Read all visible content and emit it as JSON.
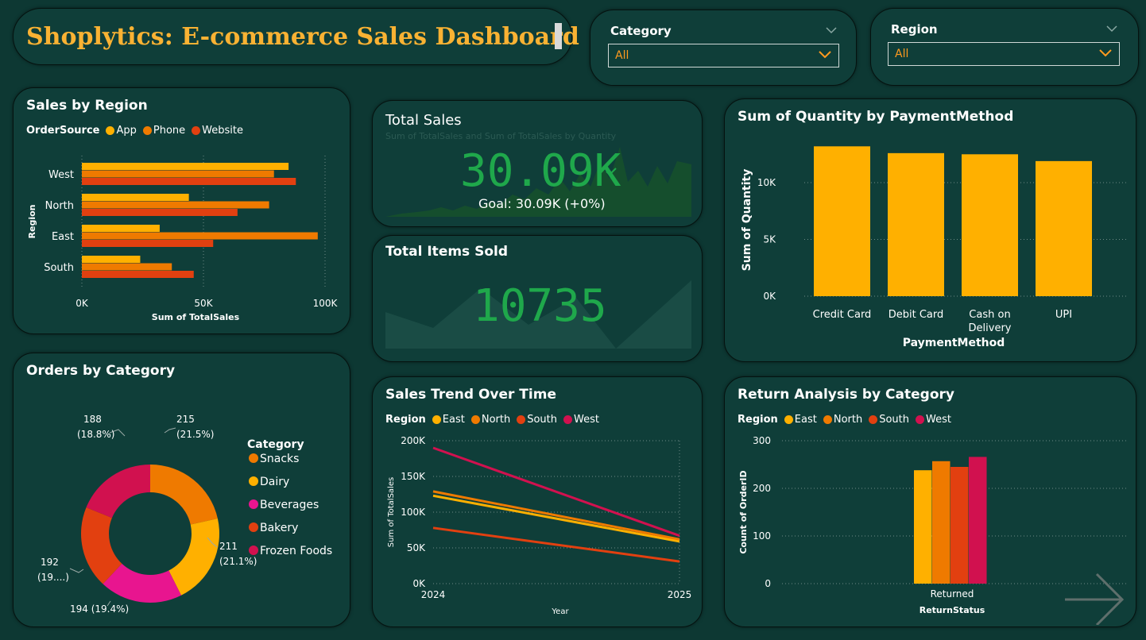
{
  "header": {
    "title": "Shoplytics: E-commerce Sales Dashboard"
  },
  "slicers": [
    {
      "label": "Category",
      "value": "All"
    },
    {
      "label": "Region",
      "value": "All"
    }
  ],
  "colors": {
    "background": "#0d3833",
    "yellow": "#ffb000",
    "orange": "#ef7a00",
    "red": "#e24010",
    "magenta": "#e01a7a",
    "crimson": "#d1114f",
    "green": "#1fa84b"
  },
  "kpis": {
    "total_sales": {
      "title": "Total Sales",
      "value": "30.09K",
      "goal": "Goal: 30.09K (+0%)",
      "faded_caption": "Sum of TotalSales and Sum of TotalSales by Quantity"
    },
    "total_items": {
      "title": "Total Items Sold",
      "value": "10735"
    }
  },
  "icons": {
    "kpi_check": "check-icon",
    "nav": "arrow-right-icon",
    "dropdown": "chevron-down-icon"
  },
  "chart_data": [
    {
      "id": "sales_by_region",
      "type": "bar",
      "orientation": "horizontal",
      "title": "Sales by Region",
      "legend_title": "OrderSource",
      "categories": [
        "West",
        "North",
        "East",
        "South"
      ],
      "series": [
        {
          "name": "App",
          "color": "#ffb000",
          "values": [
            85000,
            44000,
            32000,
            24000
          ]
        },
        {
          "name": "Phone",
          "color": "#ef7a00",
          "values": [
            79000,
            77000,
            97000,
            37000
          ]
        },
        {
          "name": "Website",
          "color": "#e24010",
          "values": [
            88000,
            64000,
            54000,
            46000
          ]
        }
      ],
      "xlabel": "Sum of TotalSales",
      "ylabel": "Region",
      "xlim": [
        0,
        100000
      ],
      "ticks": [
        "0K",
        "50K",
        "100K"
      ],
      "tick_values": [
        0,
        50000,
        100000
      ],
      "grid": true,
      "legend_position": "top"
    },
    {
      "id": "orders_by_category",
      "type": "pie",
      "donut": true,
      "title": "Orders by Category",
      "legend_title": "Category",
      "slices": [
        {
          "name": "Snacks",
          "value": 215,
          "label": "215",
          "pct": "(21.5%)",
          "color": "#ef7a00"
        },
        {
          "name": "Dairy",
          "value": 211,
          "label": "211",
          "pct": "(21.1%)",
          "color": "#ffb000"
        },
        {
          "name": "Beverages",
          "value": 194,
          "label": "194 (19.4%)",
          "pct": "",
          "color": "#e8158f"
        },
        {
          "name": "Bakery",
          "value": 192,
          "label": "192",
          "pct": "(19....)",
          "color": "#e24010"
        },
        {
          "name": "Frozen Foods",
          "value": 188,
          "label": "188",
          "pct": "(18.8%)",
          "color": "#d1114f"
        }
      ],
      "legend_position": "right"
    },
    {
      "id": "quantity_by_payment",
      "type": "bar",
      "title": "Sum of Quantity by PaymentMethod",
      "categories": [
        "Credit Card",
        "Debit Card",
        "Cash on Delivery",
        "UPI"
      ],
      "category_lines": [
        [
          "Credit Card"
        ],
        [
          "Debit Card"
        ],
        [
          "Cash on",
          "Delivery"
        ],
        [
          "UPI"
        ]
      ],
      "values": [
        13200,
        12600,
        12500,
        11900
      ],
      "color": "#ffb000",
      "xlabel": "PaymentMethod",
      "ylabel": "Sum of Quantity",
      "ylim": [
        0,
        13500
      ],
      "ticks": [
        "0K",
        "5K",
        "10K"
      ],
      "tick_values": [
        0,
        5000,
        10000
      ],
      "grid": true
    },
    {
      "id": "sales_trend",
      "type": "line",
      "title": "Sales Trend Over Time",
      "legend_title": "Region",
      "x": [
        "2024",
        "2025"
      ],
      "series": [
        {
          "name": "East",
          "color": "#ffb000",
          "values": [
            123000,
            59000
          ]
        },
        {
          "name": "North",
          "color": "#ef7a00",
          "values": [
            129000,
            62000
          ]
        },
        {
          "name": "South",
          "color": "#e24010",
          "values": [
            78000,
            31000
          ]
        },
        {
          "name": "West",
          "color": "#d1114f",
          "values": [
            190000,
            67000
          ]
        }
      ],
      "ylim": [
        0,
        200000
      ],
      "ticks": [
        "0K",
        "50K",
        "100K",
        "150K",
        "200K"
      ],
      "tick_values": [
        0,
        50000,
        100000,
        150000,
        200000
      ],
      "faded_xlabel": "Year",
      "faded_ylabel": "Sum of TotalSales",
      "grid": true,
      "legend_position": "top"
    },
    {
      "id": "return_analysis",
      "type": "bar",
      "title": "Return Analysis by Category",
      "legend_title": "Region",
      "categories": [
        "Returned"
      ],
      "series": [
        {
          "name": "East",
          "color": "#ffb000",
          "values": [
            238
          ]
        },
        {
          "name": "North",
          "color": "#ef7a00",
          "values": [
            257
          ]
        },
        {
          "name": "South",
          "color": "#e24010",
          "values": [
            245
          ]
        },
        {
          "name": "West",
          "color": "#d1114f",
          "values": [
            266
          ]
        }
      ],
      "xlabel": "ReturnStatus",
      "ylabel": "Count of OrderID",
      "ylim": [
        0,
        300
      ],
      "ticks": [
        "0",
        "100",
        "200",
        "300"
      ],
      "tick_values": [
        0,
        100,
        200,
        300
      ],
      "grid": true,
      "legend_position": "top"
    }
  ]
}
